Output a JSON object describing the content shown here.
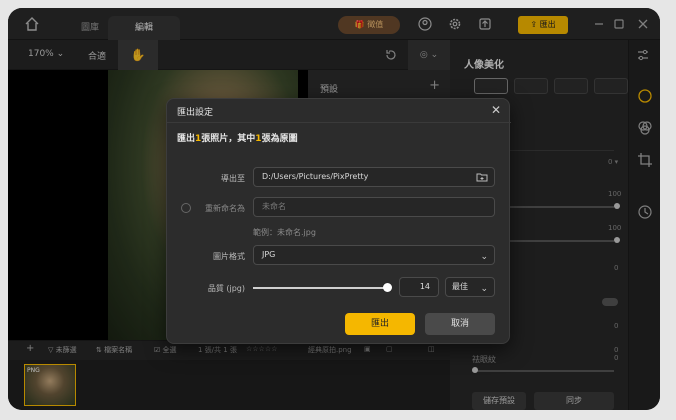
{
  "tabs": [
    {
      "label": "圖庫"
    },
    {
      "label": "編輯"
    }
  ],
  "header": {
    "fav_label": "徵值",
    "export_label": "匯出"
  },
  "toolbar": {
    "zoom": "170%",
    "fit": "合適"
  },
  "presets": {
    "title": "預設",
    "add": "+"
  },
  "panel": {
    "title": "人像美化",
    "value_0": "0 ▾",
    "value_100a": "100",
    "value_100b": "100",
    "zero_a": "0",
    "zero_b": "0",
    "zero_c": "0",
    "zero_d": "0",
    "label_bottom": "祛眼紋",
    "btn_save": "儲存預設",
    "btn_sync": "同步"
  },
  "strip": {
    "unselected": "未篩選",
    "filename_sort": "檔案名稱",
    "select_all": "☑ 全選",
    "count": "1 張/共 1 張",
    "stars": "☆☆☆☆☆",
    "filename": "經典原拍.png"
  },
  "thumb": {
    "tag": "PNG"
  },
  "dialog": {
    "title": "匯出設定",
    "summary_pre": "匯出",
    "summary_n1": "1",
    "summary_mid": "張照片，其中",
    "summary_n2": "1",
    "summary_post": "張為原圖",
    "export_to_label": "導出至",
    "export_path": "D:/Users/Pictures/PixPretty",
    "rename_label": "重新命名為",
    "rename_placeholder": "未命名",
    "example": "範例：未命名.jpg",
    "format_label": "圖片格式",
    "format_value": "JPG",
    "quality_label": "品質 (jpg)",
    "quality_value": "14",
    "quality_preset": "最佳",
    "export_button": "匯出",
    "cancel_button": "取消"
  },
  "colors": {
    "accent": "#f5b700",
    "background": "#232323"
  }
}
